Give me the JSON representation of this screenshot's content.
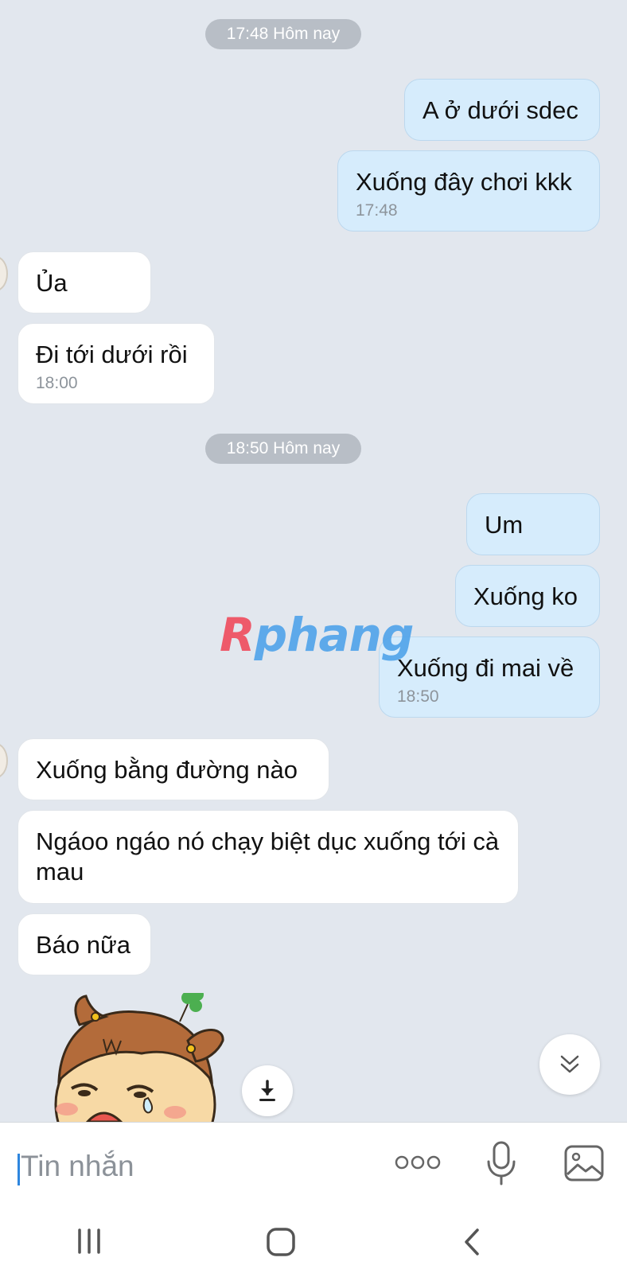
{
  "chat": {
    "timestamp_pills": [
      "17:48 Hôm nay",
      "18:50 Hôm nay"
    ],
    "messages": [
      {
        "dir": "out",
        "text": "A ở dưới sdec"
      },
      {
        "dir": "out",
        "text": "Xuống đây chơi kkk",
        "time": "17:48"
      },
      {
        "dir": "in",
        "text": "Ủa"
      },
      {
        "dir": "in",
        "text": "Đi tới dưới rồi",
        "time": "18:00"
      },
      {
        "dir": "out",
        "text": "Um"
      },
      {
        "dir": "out",
        "text": "Xuống ko"
      },
      {
        "dir": "out",
        "text": "Xuống đi mai về",
        "time": "18:50"
      },
      {
        "dir": "in",
        "text": "Xuống bằng đường nào"
      },
      {
        "dir": "in",
        "text": "Ngáoo ngáo nó chạy biệt dục xuống tới cà mau"
      },
      {
        "dir": "in",
        "text": "Báo nữa"
      }
    ],
    "watermark": {
      "first": "R",
      "rest": "phang"
    }
  },
  "input": {
    "placeholder": "Tin nhắn"
  },
  "colors": {
    "background": "#e2e7ee",
    "outgoing_bubble": "#d6ecfc",
    "incoming_bubble": "#ffffff",
    "pill": "#b8bec6",
    "caret": "#2e86de"
  },
  "icons": {
    "download": "download-icon",
    "scroll_down": "double-chevron-down-icon",
    "more": "more-dots-icon",
    "mic": "microphone-icon",
    "image": "image-icon",
    "nav_recents": "recent-apps-icon",
    "nav_home": "home-icon",
    "nav_back": "back-icon"
  }
}
